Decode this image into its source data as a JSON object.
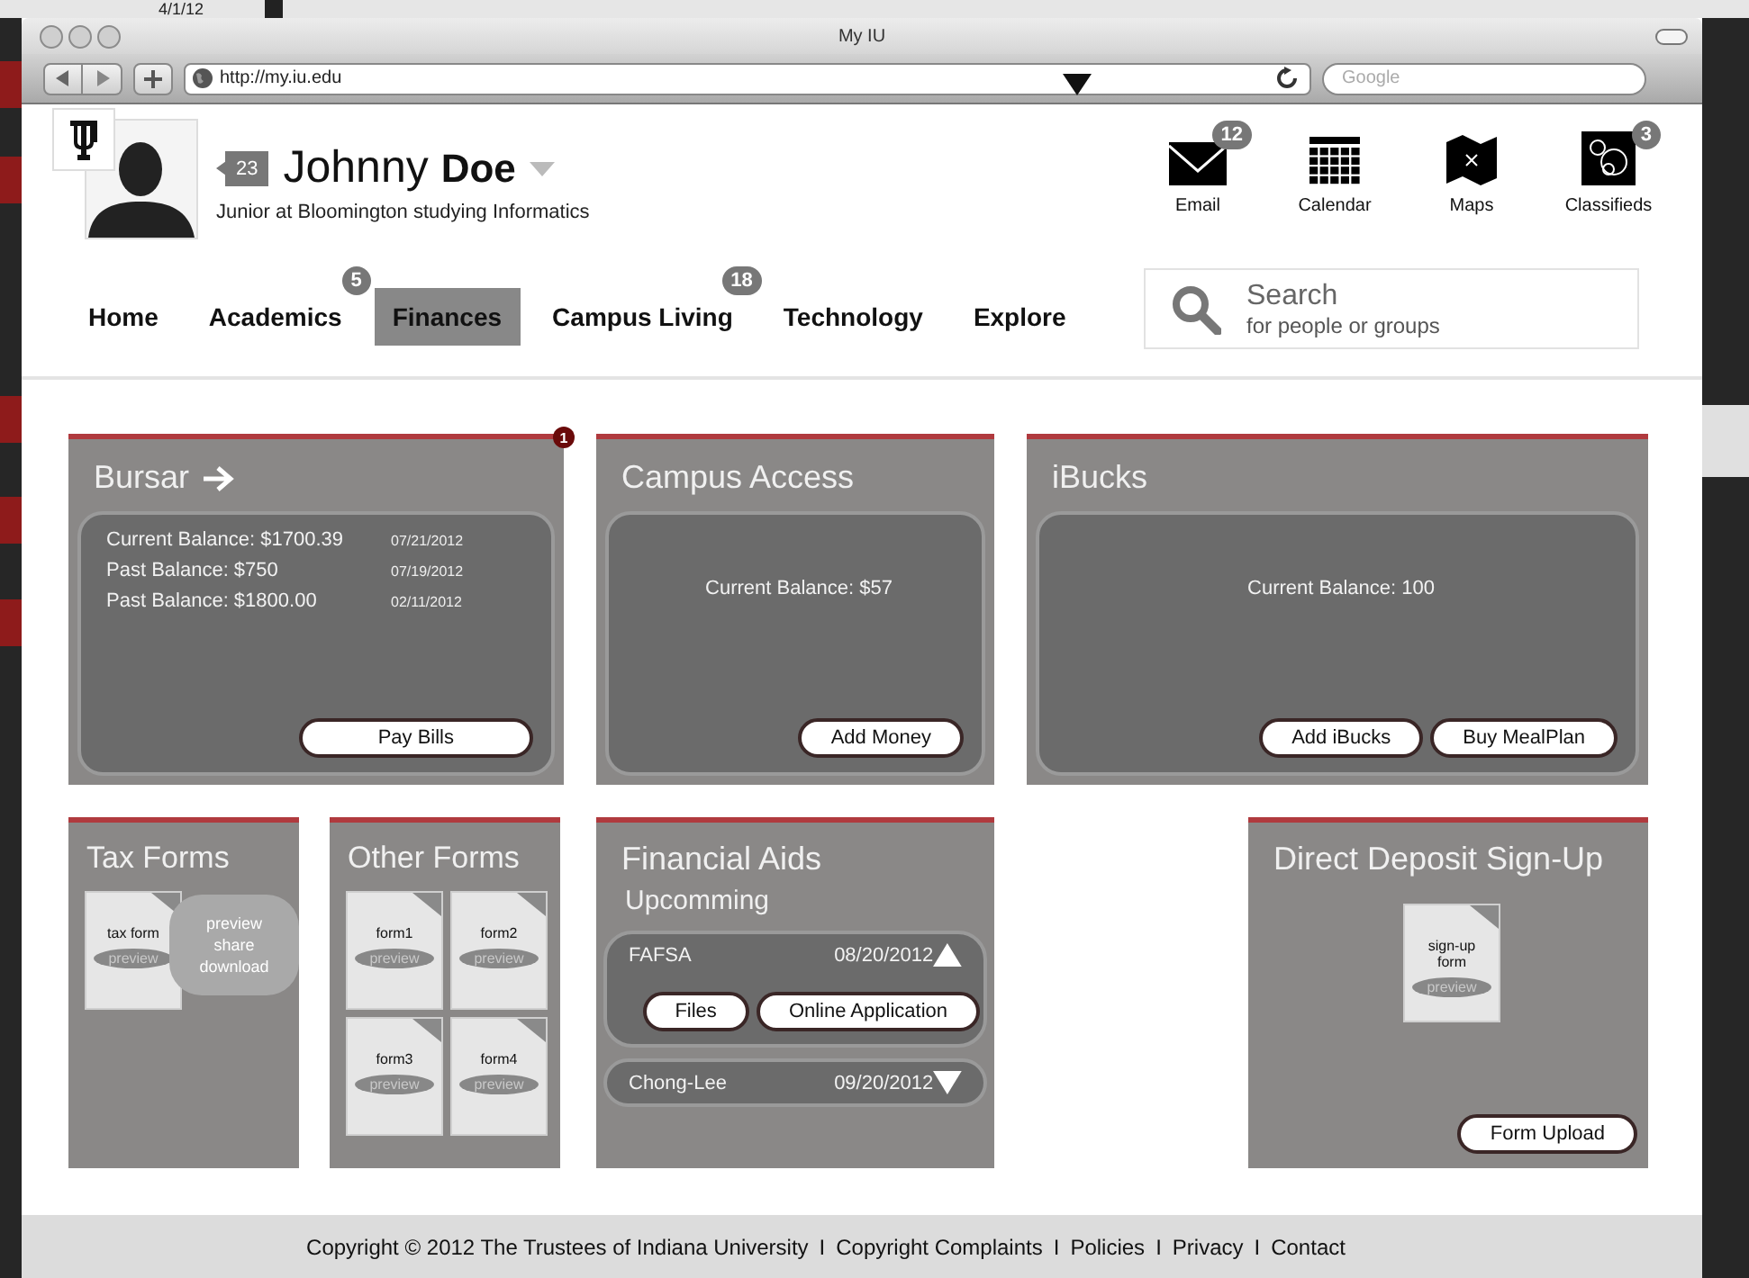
{
  "desktop": {
    "date": "4/1/12"
  },
  "browser": {
    "title": "My IU",
    "url": "http://my.iu.edu",
    "search_placeholder": "Google"
  },
  "profile": {
    "badge": "23",
    "first_name": "Johnny",
    "last_name": "Doe",
    "subtitle": "Junior at Bloomington studying Informatics"
  },
  "apps": [
    {
      "kind": "email",
      "label": "Email",
      "badge": "12"
    },
    {
      "kind": "calendar",
      "label": "Calendar"
    },
    {
      "kind": "maps",
      "label": "Maps"
    },
    {
      "kind": "classifieds",
      "label": "Classifieds",
      "badge": "3"
    }
  ],
  "nav": [
    {
      "label": "Home",
      "selected": false
    },
    {
      "label": "Academics",
      "badge": "5",
      "selected": false
    },
    {
      "label": "Finances",
      "selected": true
    },
    {
      "label": "Campus Living",
      "badge": "18",
      "selected": false
    },
    {
      "label": "Technology",
      "selected": false
    },
    {
      "label": "Explore",
      "selected": false
    }
  ],
  "search": {
    "placeholder": "Search",
    "hint": "for people or groups"
  },
  "row_1": [
    {
      "kind": "bursar",
      "title": "Bursar",
      "link_arrow": true,
      "badge": "1",
      "rows": [
        {
          "label": "Current Balance: $1700.39",
          "date": "07/21/2012"
        },
        {
          "label": "Past Balance: $750",
          "date": "07/19/2012"
        },
        {
          "label": "Past Balance: $1800.00",
          "date": "02/11/2012"
        }
      ],
      "buttons": [
        "Pay Bills"
      ]
    },
    {
      "kind": "balance",
      "title": "Campus Access",
      "balance": "Current Balance: $57",
      "buttons": [
        "Add Money"
      ]
    },
    {
      "kind": "balance",
      "title": "iBucks",
      "balance": "Current Balance: 100",
      "buttons": [
        "Add iBucks",
        "Buy MealPlan"
      ]
    }
  ],
  "row_2": [
    {
      "kind": "forms",
      "title": "Tax Forms",
      "forms": [
        {
          "label": "tax form",
          "action": "preview"
        }
      ],
      "menu": [
        "preview",
        "share",
        "download"
      ]
    },
    {
      "kind": "forms",
      "title": "Other Forms",
      "forms": [
        {
          "label": "form1",
          "action": "preview"
        },
        {
          "label": "form2",
          "action": "preview"
        },
        {
          "label": "form3",
          "action": "preview"
        },
        {
          "label": "form4",
          "action": "preview"
        }
      ]
    },
    {
      "kind": "aid",
      "title": "Financial Aids",
      "subtitle": "Upcomming",
      "items": [
        {
          "name": "FAFSA",
          "date": "08/20/2012",
          "expanded": true,
          "buttons": [
            "Files",
            "Online Application"
          ]
        },
        {
          "name": "Chong-Lee",
          "date": "09/20/2012",
          "expanded": false
        }
      ]
    },
    {
      "kind": "deposit",
      "title": "Direct Deposit Sign-Up",
      "forms": [
        {
          "label": "sign-up form",
          "action": "preview"
        }
      ],
      "buttons": [
        "Form Upload"
      ]
    }
  ],
  "footer": {
    "copyright": "Copyright © 2012 The Trustees of Indiana University",
    "links": [
      {
        "separator": "I",
        "text": "Copyright Complaints"
      },
      {
        "separator": "I",
        "text": "Policies"
      },
      {
        "separator": "I",
        "text": "Privacy"
      },
      {
        "separator": "I",
        "text": "Contact"
      }
    ]
  }
}
